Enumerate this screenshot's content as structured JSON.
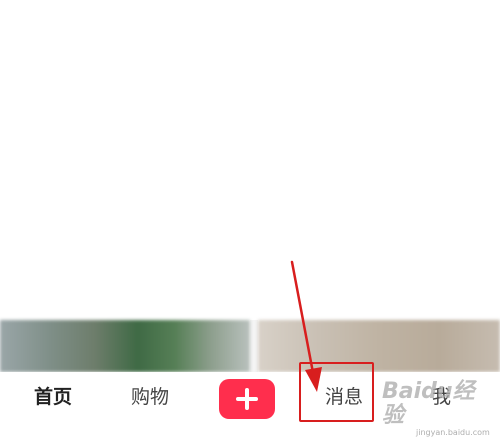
{
  "tab_bar": {
    "home_label": "首页",
    "shop_label": "购物",
    "messages_label": "消息",
    "me_label": "我"
  },
  "publish_button": {
    "icon": "plus-icon",
    "color": "#ff2e4d"
  },
  "annotation": {
    "color": "#d81e1e",
    "target": "消息"
  },
  "watermark": {
    "logo": "Baidu经验",
    "url": "jingyan.baidu.com"
  }
}
